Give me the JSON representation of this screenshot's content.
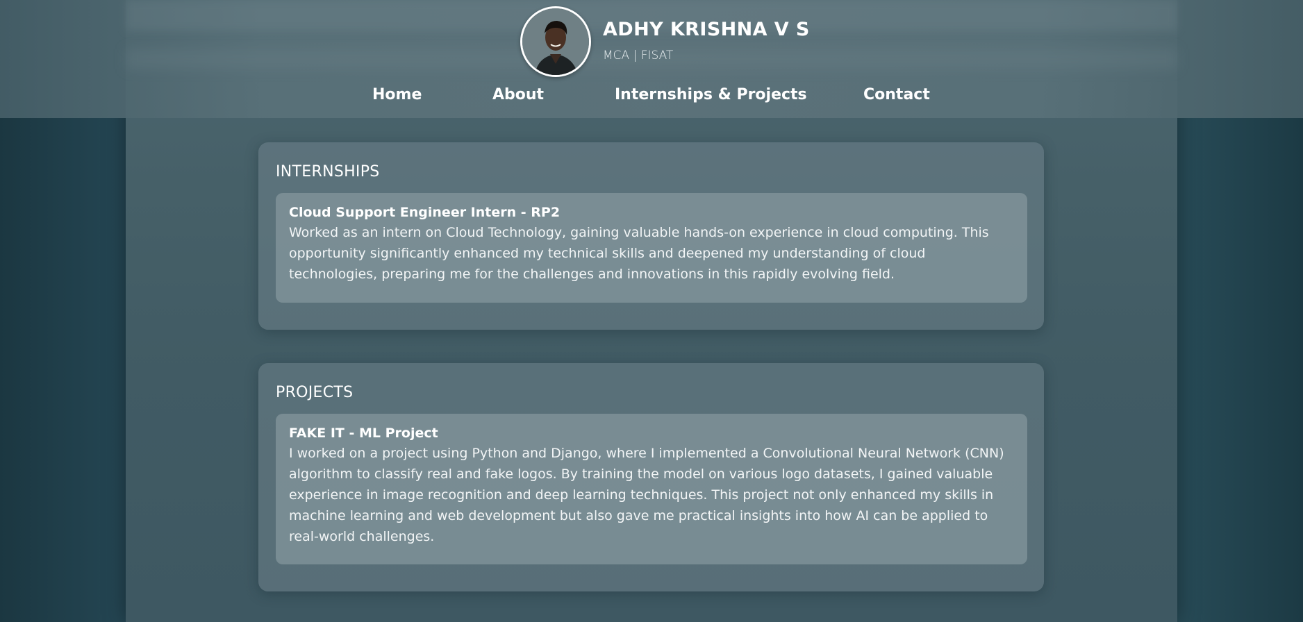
{
  "header": {
    "name": "ADHY KRISHNA V S",
    "subtitle": "MCA | FISAT",
    "avatar_icon": "profile-photo"
  },
  "nav": {
    "items": [
      {
        "label": "Home"
      },
      {
        "label": "About"
      },
      {
        "label": "Internships & Projects"
      },
      {
        "label": "Contact"
      }
    ]
  },
  "internships": {
    "heading": "INTERNSHIPS",
    "entries": [
      {
        "title": "Cloud Support Engineer Intern - RP2",
        "description": "Worked as an intern on Cloud Technology, gaining valuable hands-on experience in cloud computing. This opportunity significantly enhanced my technical skills and deepened my understanding of cloud technologies, preparing me for the challenges and innovations in this rapidly evolving field."
      }
    ]
  },
  "projects": {
    "heading": "PROJECTS",
    "entries": [
      {
        "title": "FAKE IT - ML Project",
        "description": "I worked on a project using Python and Django, where I implemented a Convolutional Neural Network (CNN) algorithm to classify real and fake logos. By training the model on various logo datasets, I gained valuable experience in image recognition and deep learning techniques. This project not only enhanced my skills in machine learning and web development but also gave me practical insights into how AI can be applied to real-world challenges."
      }
    ]
  },
  "colors": {
    "text": "#ffffff",
    "background": "#2a4a58",
    "card": "#6e828a"
  }
}
